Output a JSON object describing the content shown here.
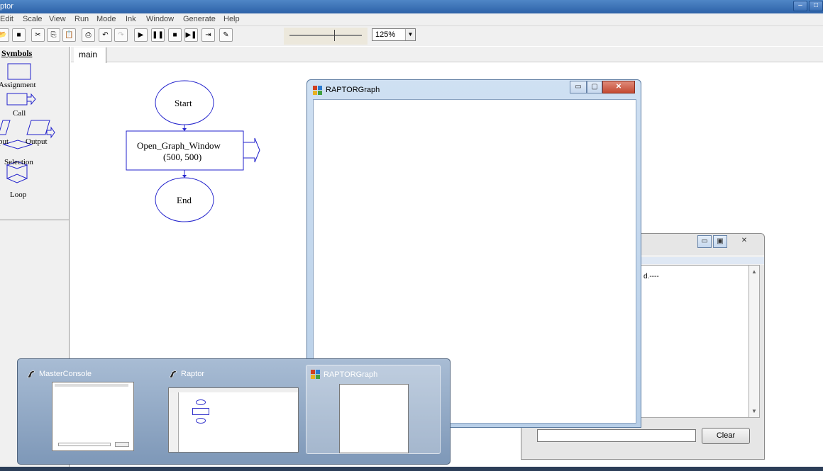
{
  "titlebar": {
    "title": "ptor",
    "min": "–",
    "max": "□"
  },
  "menu": [
    "Edit",
    "Scale",
    "View",
    "Run",
    "Mode",
    "Ink",
    "Window",
    "Generate",
    "Help"
  ],
  "toolbar": {
    "buttons": [
      "open-icon",
      "save-icon",
      "cut-icon",
      "copy-icon",
      "paste-icon",
      "print-icon",
      "undo-icon",
      "redo-icon",
      "run-icon",
      "pause-icon",
      "stop-icon",
      "step-icon",
      "test-icon",
      "pen-icon"
    ],
    "zoom_value": "125%",
    "zoom_slider_level": 0.64
  },
  "symbols": {
    "header": "Symbols",
    "items": [
      "Assignment",
      "Call",
      "put",
      "Output",
      "Selection",
      "Loop"
    ]
  },
  "tab": {
    "label": "main"
  },
  "flowchart": {
    "start": "Start",
    "call_line1": "Open_Graph_Window",
    "call_line2": "(500, 500)",
    "end": "End"
  },
  "graph_window": {
    "title": "RAPTORGraph"
  },
  "console_window": {
    "text_fragment": "d.----",
    "clear_label": "Clear"
  },
  "task_thumbnails": [
    {
      "title": "MasterConsole"
    },
    {
      "title": "Raptor"
    },
    {
      "title": "RAPTORGraph"
    }
  ]
}
